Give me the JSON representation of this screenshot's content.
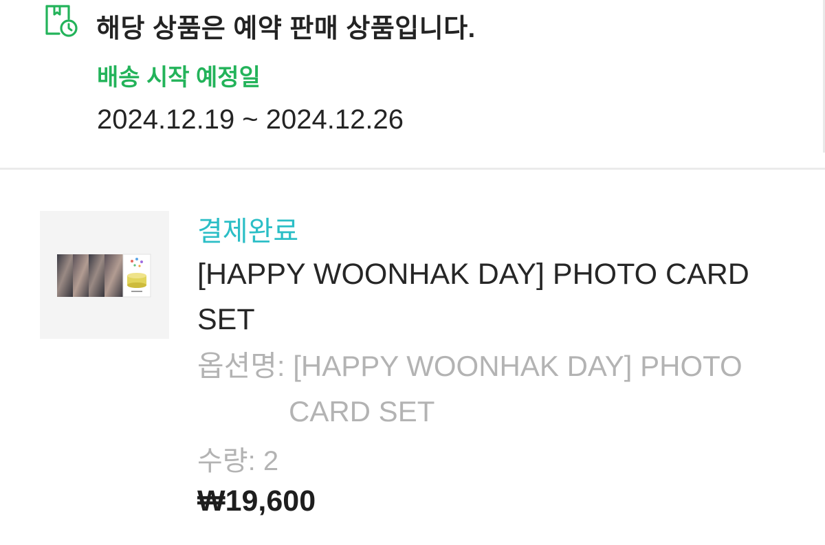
{
  "preorder_notice": {
    "icon": "calendar-clock-icon",
    "title": "해당 상품은 예약 판매 상품입니다.",
    "shipping_label": "배송 시작 예정일",
    "shipping_dates": "2024.12.19 ~ 2024.12.26",
    "accent_color": "#23b35a"
  },
  "order_item": {
    "status": "결제완료",
    "status_color": "#2bbec6",
    "product_name": "[HAPPY WOONHAK DAY] PHOTO CARD SET",
    "option_label": "옵션명:",
    "option_value_line1": "[HAPPY WOONHAK DAY] PHOTO",
    "option_value_line2": "CARD SET",
    "quantity": "수량: 2",
    "price": "₩19,600"
  }
}
